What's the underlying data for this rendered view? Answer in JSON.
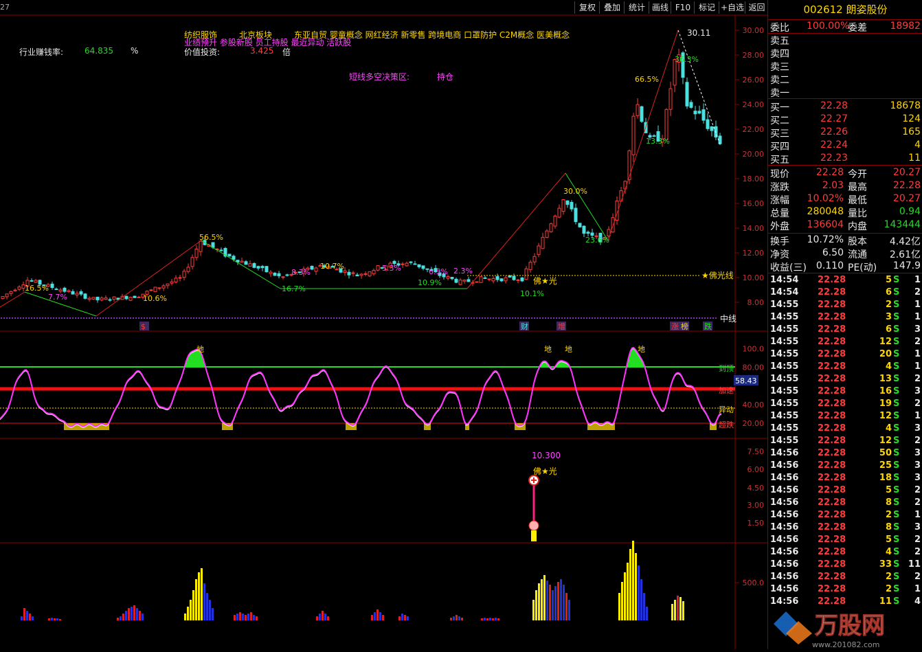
{
  "toolbar": {
    "left_label": "27",
    "buttons": [
      "复权",
      "叠加",
      "统计",
      "画线",
      "F10",
      "标记",
      "+自选",
      "返回"
    ]
  },
  "stock": {
    "code": "002612",
    "name": "朗姿股份"
  },
  "header": {
    "concepts_line1": "纺织服饰",
    "region": "北京板块",
    "concepts_line1b": "东亚自贸 婴童概念 网红经济 新零售 跨境电商 口罩防护 C2M概念 医美概念",
    "concepts_line2": "业绩预升 参股新股 员工持股 最近异动 活跃股",
    "industry_label": "行业赚钱率:",
    "industry_value": "64.835",
    "industry_unit": "%",
    "value_label": "价值投资:",
    "value_value": "3.425",
    "value_unit": "倍",
    "zone_label": "短线多空决策区:",
    "zone_value": "持仓"
  },
  "main_chart": {
    "y_ticks": [
      "30.00",
      "28.00",
      "26.00",
      "24.00",
      "22.00",
      "20.00",
      "18.00",
      "16.00",
      "14.00",
      "12.00",
      "10.00",
      "8.00"
    ],
    "peak_label": "30.11",
    "foguang_label": "★佛光线",
    "foguang_marker": "佛★光",
    "mid_label": "中线",
    "pct_labels": [
      "16.5%",
      "7.7%",
      "10.6%",
      "56.5%",
      "16.7%",
      "8.3%",
      "10.7%",
      "5.3%",
      "6.5%",
      "10.9%",
      "2.3%",
      "10.1%",
      "30.0%",
      "23.6%",
      "66.5%",
      "13.3%",
      "36.3%"
    ],
    "event_labels": [
      "$",
      "财",
      "增",
      "涨",
      "榜",
      "跌"
    ]
  },
  "osc_chart": {
    "y_ticks": [
      "100.0",
      "80.00",
      "40.00",
      "20.00"
    ],
    "value_badge": "58.43",
    "right_labels": [
      "到顶",
      "加速",
      "异动",
      "超跌"
    ],
    "peak_marks": [
      "地",
      "地",
      "地",
      "地"
    ]
  },
  "signal_chart": {
    "y_ticks": [
      "7.50",
      "6.00",
      "4.50",
      "3.00",
      "1.50"
    ],
    "value": "10.300",
    "marker": "佛★光"
  },
  "volume_chart": {
    "y_ticks": [
      "500.0"
    ]
  },
  "quote_panel": {
    "webi_label": "委比",
    "webi_value": "100.00%",
    "wecha_label": "委差",
    "wecha_value": "18982",
    "sell_labels": [
      "卖五",
      "卖四",
      "卖三",
      "卖二",
      "卖一"
    ],
    "buy": [
      {
        "label": "买一",
        "price": "22.28",
        "vol": "18678"
      },
      {
        "label": "买二",
        "price": "22.27",
        "vol": "124"
      },
      {
        "label": "买三",
        "price": "22.26",
        "vol": "165"
      },
      {
        "label": "买四",
        "price": "22.24",
        "vol": "4"
      },
      {
        "label": "买五",
        "price": "22.23",
        "vol": "11"
      }
    ],
    "stats": [
      {
        "l1": "现价",
        "v1": "22.28",
        "l2": "今开",
        "v2": "20.27"
      },
      {
        "l1": "涨跌",
        "v1": "2.03",
        "l2": "最高",
        "v2": "22.28"
      },
      {
        "l1": "涨幅",
        "v1": "10.02%",
        "l2": "最低",
        "v2": "20.27"
      },
      {
        "l1": "总量",
        "v1": "280048",
        "l2": "量比",
        "v2": "0.94"
      },
      {
        "l1": "外盘",
        "v1": "136604",
        "l2": "内盘",
        "v2": "143444"
      }
    ],
    "stats2": [
      {
        "l1": "换手",
        "v1": "10.72%",
        "l2": "股本",
        "v2": "4.42亿"
      },
      {
        "l1": "净资",
        "v1": "6.50",
        "l2": "流通",
        "v2": "2.61亿"
      },
      {
        "l1": "收益(三)",
        "v1": "0.110",
        "l2": "PE(动)",
        "v2": "147.9"
      }
    ],
    "ticks": [
      [
        "14:54",
        "22.28",
        "5",
        "S",
        "1"
      ],
      [
        "14:54",
        "22.28",
        "6",
        "S",
        "2"
      ],
      [
        "14:55",
        "22.28",
        "2",
        "S",
        "1"
      ],
      [
        "14:55",
        "22.28",
        "3",
        "S",
        "1"
      ],
      [
        "14:55",
        "22.28",
        "6",
        "S",
        "3"
      ],
      [
        "14:55",
        "22.28",
        "12",
        "S",
        "2"
      ],
      [
        "14:55",
        "22.28",
        "20",
        "S",
        "1"
      ],
      [
        "14:55",
        "22.28",
        "4",
        "S",
        "1"
      ],
      [
        "14:55",
        "22.28",
        "13",
        "S",
        "2"
      ],
      [
        "14:55",
        "22.28",
        "16",
        "S",
        "3"
      ],
      [
        "14:55",
        "22.28",
        "19",
        "S",
        "2"
      ],
      [
        "14:55",
        "22.28",
        "12",
        "S",
        "1"
      ],
      [
        "14:55",
        "22.28",
        "4",
        "S",
        "3"
      ],
      [
        "14:55",
        "22.28",
        "12",
        "S",
        "2"
      ],
      [
        "14:56",
        "22.28",
        "50",
        "S",
        "3"
      ],
      [
        "14:56",
        "22.28",
        "25",
        "S",
        "3"
      ],
      [
        "14:56",
        "22.28",
        "18",
        "S",
        "3"
      ],
      [
        "14:56",
        "22.28",
        "5",
        "S",
        "2"
      ],
      [
        "14:56",
        "22.28",
        "8",
        "S",
        "2"
      ],
      [
        "14:56",
        "22.28",
        "2",
        "S",
        "1"
      ],
      [
        "14:56",
        "22.28",
        "8",
        "S",
        "3"
      ],
      [
        "14:56",
        "22.28",
        "5",
        "S",
        "2"
      ],
      [
        "14:56",
        "22.28",
        "4",
        "S",
        "2"
      ],
      [
        "14:56",
        "22.28",
        "33",
        "S",
        "11"
      ],
      [
        "14:56",
        "22.28",
        "2",
        "S",
        "2"
      ],
      [
        "14:56",
        "22.28",
        "2",
        "S",
        "1"
      ],
      [
        "14:56",
        "22.28",
        "11",
        "S",
        "4"
      ]
    ]
  },
  "watermark": {
    "text": "万股网",
    "url": "www.201082.com"
  },
  "colors": {
    "up": "#ff3b3b",
    "down": "#22dd22",
    "accent": "#ffd700",
    "cyan": "#4be0e0",
    "magenta": "#ff44ff",
    "grid": "#8b0000"
  }
}
